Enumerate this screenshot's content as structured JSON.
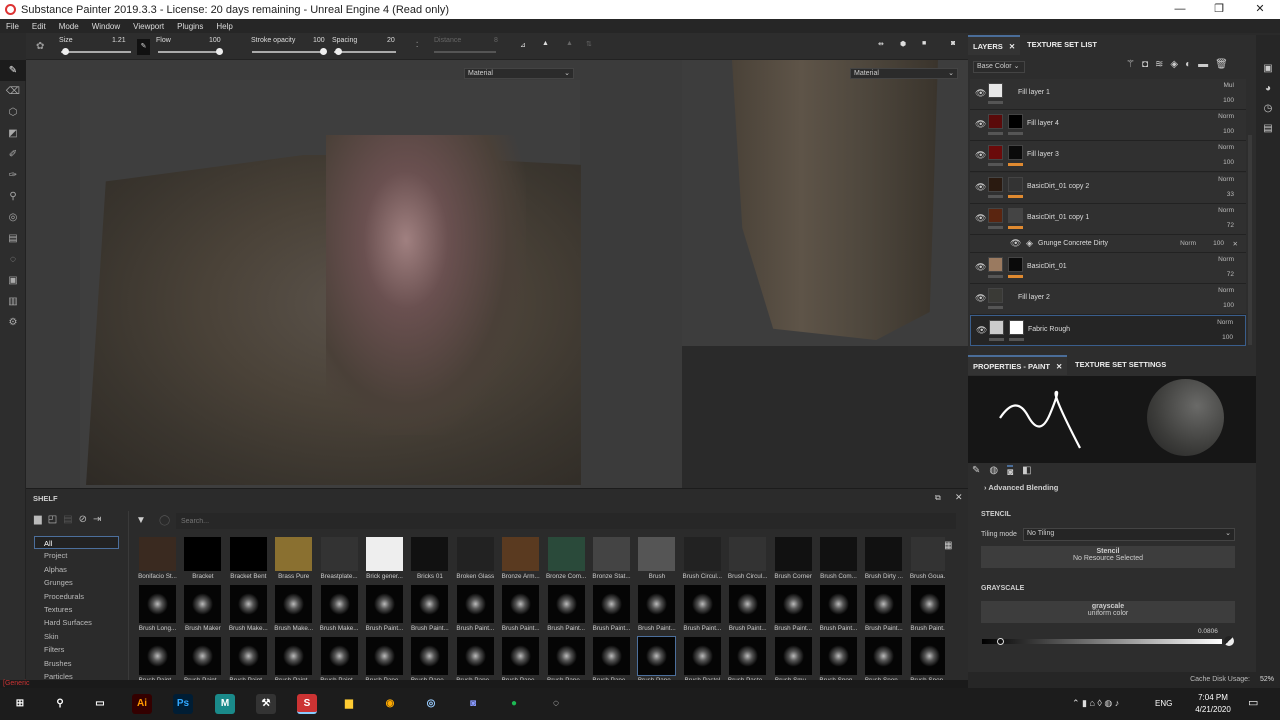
{
  "window": {
    "title": "Substance Painter 2019.3.3 - License: 20 days remaining - Unreal Engine 4 (Read only)"
  },
  "menu": [
    "File",
    "Edit",
    "Mode",
    "Window",
    "Viewport",
    "Plugins",
    "Help"
  ],
  "toolbar": {
    "size_label": "Size",
    "size_value": "1.21",
    "flow_label": "Flow",
    "flow_value": "100",
    "stroke_opacity_label": "Stroke opacity",
    "stroke_opacity_value": "100",
    "spacing_label": "Spacing",
    "spacing_value": "20",
    "distance_label": "Distance",
    "distance_value": "8"
  },
  "viewport": {
    "mode_3d": "Material",
    "mode_2d": "Material"
  },
  "layers_panel": {
    "tabs": [
      "LAYERS",
      "TEXTURE SET LIST"
    ],
    "channel": "Base Color",
    "layers": [
      {
        "name": "Fill layer 1",
        "blend": "Mul",
        "opacity": "100",
        "c1": "#e8e8e8",
        "c2": ""
      },
      {
        "name": "Fill layer 4",
        "blend": "Norm",
        "opacity": "100",
        "c1": "#5a0a0a",
        "c2": "#000"
      },
      {
        "name": "Fill layer 3",
        "blend": "Norm",
        "opacity": "100",
        "c1": "#6a0a0a",
        "c2": "#0a0a0a",
        "orange": true
      },
      {
        "name": "BasicDirt_01 copy 2",
        "blend": "Norm",
        "opacity": "33",
        "c1": "#2a1a10",
        "c2": "#333",
        "orange": true
      },
      {
        "name": "BasicDirt_01 copy 1",
        "blend": "Norm",
        "opacity": "72",
        "c1": "#5a2510",
        "c2": "#444",
        "orange": true
      },
      {
        "name": "BasicDirt_01",
        "blend": "Norm",
        "opacity": "72",
        "c1": "#9a7a60",
        "c2": "#0a0a0a",
        "orange": true
      },
      {
        "name": "Fill layer 2",
        "blend": "Norm",
        "opacity": "100",
        "c1": "#3a3a36",
        "c2": ""
      },
      {
        "name": "Fabric Rough",
        "blend": "Norm",
        "opacity": "100",
        "c1": "#ccc",
        "c2": "#fff",
        "active": true
      }
    ],
    "sublayer": {
      "name": "Grunge Concrete Dirty",
      "blend": "Norm",
      "opacity": "100"
    }
  },
  "properties": {
    "tabs": [
      "PROPERTIES - PAINT",
      "TEXTURE SET SETTINGS"
    ],
    "advanced_blending": "Advanced Blending",
    "stencil_header": "STENCIL",
    "tiling_label": "Tiling mode",
    "tiling_value": "No Tiling",
    "stencil_title": "Stencil",
    "stencil_sub": "No Resource Selected",
    "grayscale_header": "GRAYSCALE",
    "grayscale_title": "grayscale",
    "grayscale_sub": "uniform color",
    "grayscale_value": "0.0806",
    "cache_label": "Cache Disk Usage:",
    "cache_value": "52%"
  },
  "shelf": {
    "title": "SHELF",
    "search_placeholder": "Search...",
    "categories": [
      "All",
      "Project",
      "Alphas",
      "Grunges",
      "Procedurals",
      "Textures",
      "Hard Surfaces",
      "Skin",
      "Filters",
      "Brushes",
      "Particles"
    ],
    "rows": [
      [
        "Bonifacio St...",
        "Bracket",
        "Bracket Bent",
        "Brass Pure",
        "Breastplate...",
        "Brick gener...",
        "Bricks 01",
        "Broken Glass",
        "Bronze Arm...",
        "Bronze Com...",
        "Bronze Stat...",
        "Brush",
        "Brush Circul...",
        "Brush Circul...",
        "Brush Corner",
        "Brush Com...",
        "Brush Dirty ...",
        "Brush Goua..."
      ],
      [
        "Brush Long...",
        "Brush Maker",
        "Brush Make...",
        "Brush Make...",
        "Brush Make...",
        "Brush Paint...",
        "Brush Paint...",
        "Brush Paint...",
        "Brush Paint...",
        "Brush Paint...",
        "Brush Paint...",
        "Brush Paint...",
        "Brush Paint...",
        "Brush Paint...",
        "Brush Paint...",
        "Brush Paint...",
        "Brush Paint...",
        "Brush Paint..."
      ],
      [
        "Brush Paint...",
        "Brush Paint...",
        "Brush Paint...",
        "Brush Paint...",
        "Brush Paint...",
        "Brush Pape...",
        "Brush Pape...",
        "Brush Pape...",
        "Brush Pape...",
        "Brush Pape...",
        "Brush Pape...",
        "Brush Pape...",
        "Brush Pastel",
        "Brush Paste...",
        "Brush Smu...",
        "Brush Spon...",
        "Brush Spon...",
        "Brush Spon..."
      ]
    ],
    "selected": [
      2,
      11
    ]
  },
  "status_text": "[Generic",
  "taskbar": {
    "lang": "ENG",
    "time": "7:04 PM",
    "date": "4/21/2020"
  }
}
